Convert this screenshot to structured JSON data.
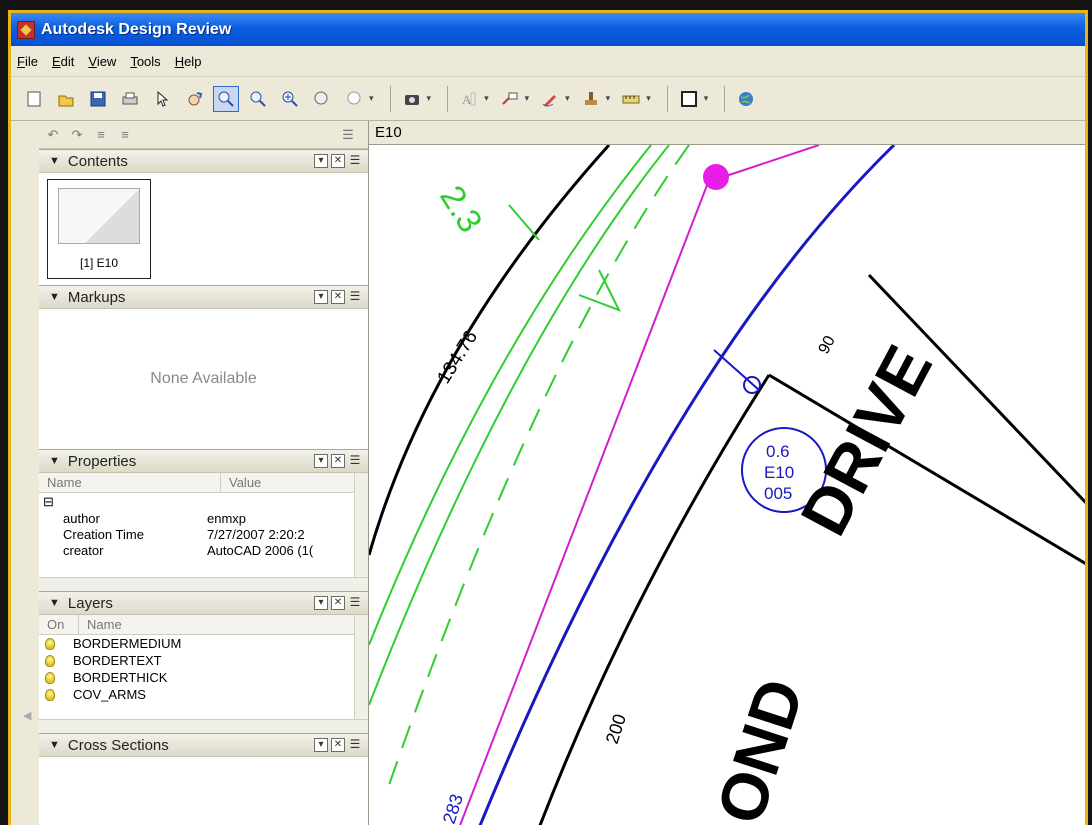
{
  "window": {
    "title": "Autodesk Design Review"
  },
  "menu": [
    {
      "u": "F",
      "rest": "ile"
    },
    {
      "u": "E",
      "rest": "dit"
    },
    {
      "u": "V",
      "rest": "iew"
    },
    {
      "u": "T",
      "rest": "ools"
    },
    {
      "u": "H",
      "rest": "elp"
    }
  ],
  "toolbar": {
    "icons": [
      "new-icon",
      "open-icon",
      "save-icon",
      "print-icon",
      "select-icon",
      "pan-icon",
      "zoom-rect-icon",
      "zoom-icon",
      "zoom-extents-icon",
      "fit-icon",
      "help-icon",
      "camera-icon",
      "text-icon",
      "callout-icon",
      "pen-icon",
      "stamp-icon",
      "measure-icon",
      "window-icon",
      "web-icon"
    ]
  },
  "panels": {
    "contents": {
      "title": "Contents",
      "thumb_label": "[1] E10"
    },
    "markups": {
      "title": "Markups",
      "empty_text": "None Available"
    },
    "properties": {
      "title": "Properties",
      "col_name": "Name",
      "col_value": "Value",
      "expander": "⊟",
      "rows": [
        {
          "name": "author",
          "value": "enmxp"
        },
        {
          "name": "Creation Time",
          "value": "7/27/2007  2:20:2"
        },
        {
          "name": "creator",
          "value": "AutoCAD 2006 (1("
        }
      ]
    },
    "layers": {
      "title": "Layers",
      "col_on": "On",
      "col_name": "Name",
      "rows": [
        "BORDERMEDIUM",
        "BORDERTEXT",
        "BORDERTHICK",
        "COV_ARMS"
      ]
    },
    "cross_sections": {
      "title": "Cross Sections"
    }
  },
  "viewer": {
    "tab_label": "E10",
    "labels": {
      "dim1": "134.76",
      "dim2": "200",
      "dim3": "2.3",
      "bubble1": "0.6",
      "bubble2": "E10",
      "bubble3": "005",
      "road1": "DRIVE",
      "road2": "OND",
      "dim4": "283",
      "dim5": "90"
    }
  }
}
